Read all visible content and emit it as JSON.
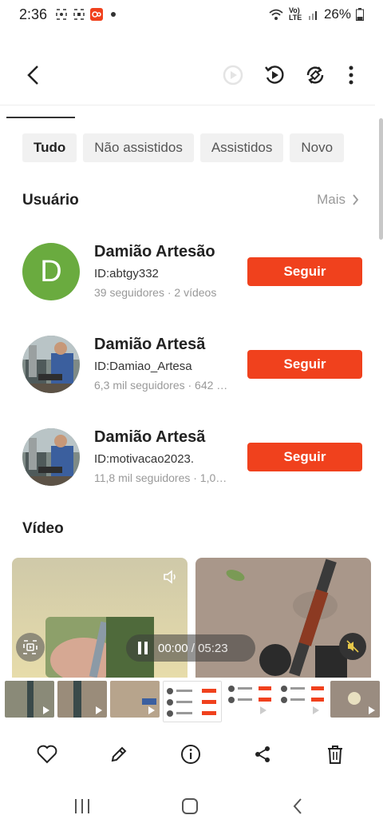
{
  "status_bar": {
    "time": "2:36",
    "network": "Vo) LTE",
    "battery": "26%"
  },
  "header": {
    "back_icon": "chevron-left-icon",
    "actions": [
      "play-circle-icon",
      "replay-icon",
      "rotate-icon",
      "more-vertical-icon"
    ]
  },
  "filters": {
    "chips": [
      {
        "label": "Tudo"
      },
      {
        "label": "Não assistidos"
      },
      {
        "label": "Assistidos"
      },
      {
        "label": "Novo"
      }
    ]
  },
  "users_section": {
    "title": "Usuário",
    "more_label": "Mais"
  },
  "users": [
    {
      "name": "Damião Artesão",
      "id": "ID:abtgy332",
      "stats": "39 seguidores · 2  vídeos",
      "avatar_letter": "D",
      "follow_label": "Seguir"
    },
    {
      "name": "Damião Artesã",
      "id": "ID:Damiao_Artesa",
      "stats": "6,3 mil seguidores · 642 …",
      "follow_label": "Seguir"
    },
    {
      "name": "Damião Artesã",
      "id": "ID:motivacao2023.",
      "stats": "11,8 mil seguidores · 1,0…",
      "follow_label": "Seguir"
    }
  ],
  "video_section": {
    "title": "Vídeo"
  },
  "player": {
    "current_time": "00:00",
    "separator": "/",
    "duration": "05:23"
  },
  "colors": {
    "accent": "#f0411d",
    "avatar_green": "#6aab3f"
  },
  "action_bar": {
    "icons": [
      "heart-icon",
      "pencil-icon",
      "info-icon",
      "share-icon",
      "trash-icon"
    ]
  },
  "nav_bar": {
    "icons": [
      "recents-icon",
      "home-icon",
      "back-icon"
    ]
  }
}
